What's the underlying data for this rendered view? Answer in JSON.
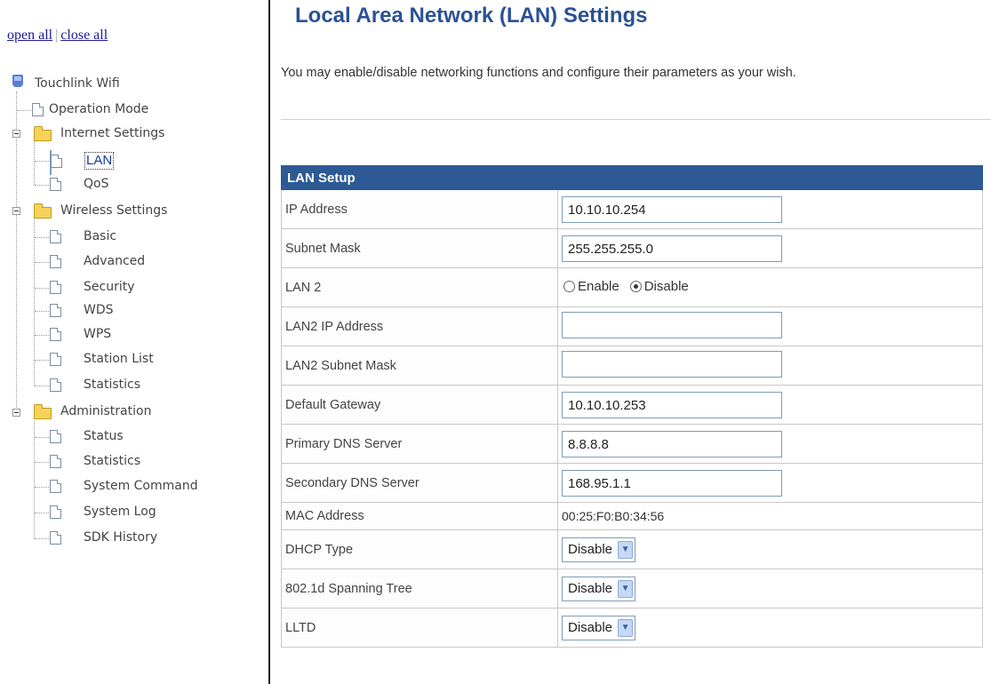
{
  "tree": {
    "open_all": "open all",
    "close_all": "close all",
    "separator": "|",
    "root": "Touchlink Wifi",
    "items": {
      "operation_mode": "Operation Mode",
      "internet_settings": "Internet Settings",
      "lan": "LAN",
      "qos": "QoS",
      "wireless_settings": "Wireless Settings",
      "basic": "Basic",
      "advanced": "Advanced",
      "security": "Security",
      "wds": "WDS",
      "wps": "WPS",
      "station_list": "Station List",
      "statistics_wireless": "Statistics",
      "administration": "Administration",
      "status": "Status",
      "statistics_admin": "Statistics",
      "system_command": "System Command",
      "system_log": "System Log",
      "sdk_history": "SDK History"
    }
  },
  "main": {
    "title": "Local Area Network (LAN) Settings",
    "intro": "You may enable/disable networking functions and configure their parameters as your wish."
  },
  "lan_setup": {
    "header": "LAN Setup",
    "ip_address": {
      "label": "IP Address",
      "value": "10.10.10.254"
    },
    "subnet_mask": {
      "label": "Subnet Mask",
      "value": "255.255.255.0"
    },
    "lan2": {
      "label": "LAN 2",
      "enable": "Enable",
      "disable": "Disable",
      "selected": "Disable"
    },
    "lan2_ip": {
      "label": "LAN2 IP Address",
      "value": ""
    },
    "lan2_mask": {
      "label": "LAN2 Subnet Mask",
      "value": ""
    },
    "gateway": {
      "label": "Default Gateway",
      "value": "10.10.10.253"
    },
    "dns1": {
      "label": "Primary DNS Server",
      "value": "8.8.8.8"
    },
    "dns2": {
      "label": "Secondary DNS Server",
      "value": "168.95.1.1"
    },
    "mac": {
      "label": "MAC Address",
      "value": "00:25:F0:B0:34:56"
    },
    "dhcp": {
      "label": "DHCP Type",
      "value": "Disable"
    },
    "stp": {
      "label": "802.1d Spanning Tree",
      "value": "Disable"
    },
    "lltd": {
      "label": "LLTD",
      "value": "Disable"
    }
  },
  "colors": {
    "header_bg": "#2d5a94",
    "title": "#2b5294"
  }
}
